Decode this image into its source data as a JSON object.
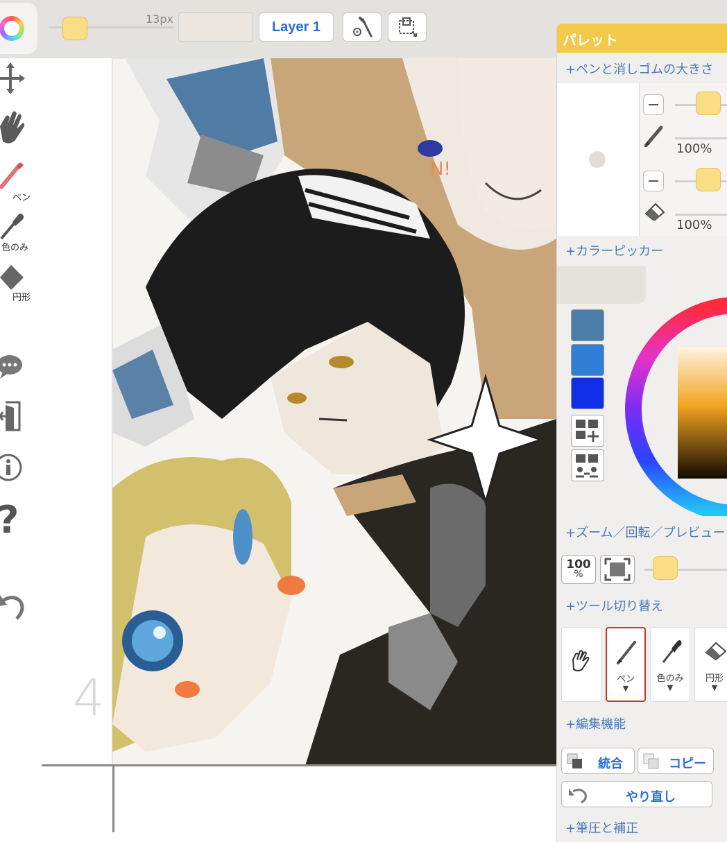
{
  "toolbar": {
    "brush_size_label": "13px",
    "layer_button_label": "Layer 1",
    "icons": [
      "color-wheel-icon",
      "brush-settings-icon",
      "transform-icon"
    ]
  },
  "left_tools": {
    "pen_label": "ペン",
    "color_only_label": "色のみ",
    "circle_label": "円形"
  },
  "canvas": {
    "page_number": "4"
  },
  "palette": {
    "title": "パレット",
    "section_brush_size": "+ペンと消しゴムの大きさ",
    "pen_percent": "100%",
    "eraser_percent": "100%",
    "section_color_picker": "+カラーピッカー",
    "swatch_colors": [
      "#4a7ea8",
      "#2f7fd6",
      "#1030e8"
    ],
    "section_zoom": "+ズーム／回転／プレビュー",
    "zoom_100_line1": "100",
    "zoom_100_line2": "%",
    "section_tool_switch": "+ツール切り替え",
    "tools": [
      {
        "label": "",
        "icon": "hand-icon"
      },
      {
        "label": "ペン",
        "arrow": "▼",
        "icon": "pen-icon"
      },
      {
        "label": "色のみ",
        "arrow": "▼",
        "icon": "dropper-icon"
      },
      {
        "label": "円形",
        "arrow": "▼",
        "icon": "eraser-icon"
      }
    ],
    "section_edit": "+編集機能",
    "merge_label": "統合",
    "copy_label": "コピー",
    "redo_label": "やり直し",
    "section_pressure": "+筆圧と補正"
  },
  "colors": {
    "accent_yellow": "#f4c84a",
    "link_blue": "#4a7ab8",
    "button_blue": "#2a6dd8"
  }
}
